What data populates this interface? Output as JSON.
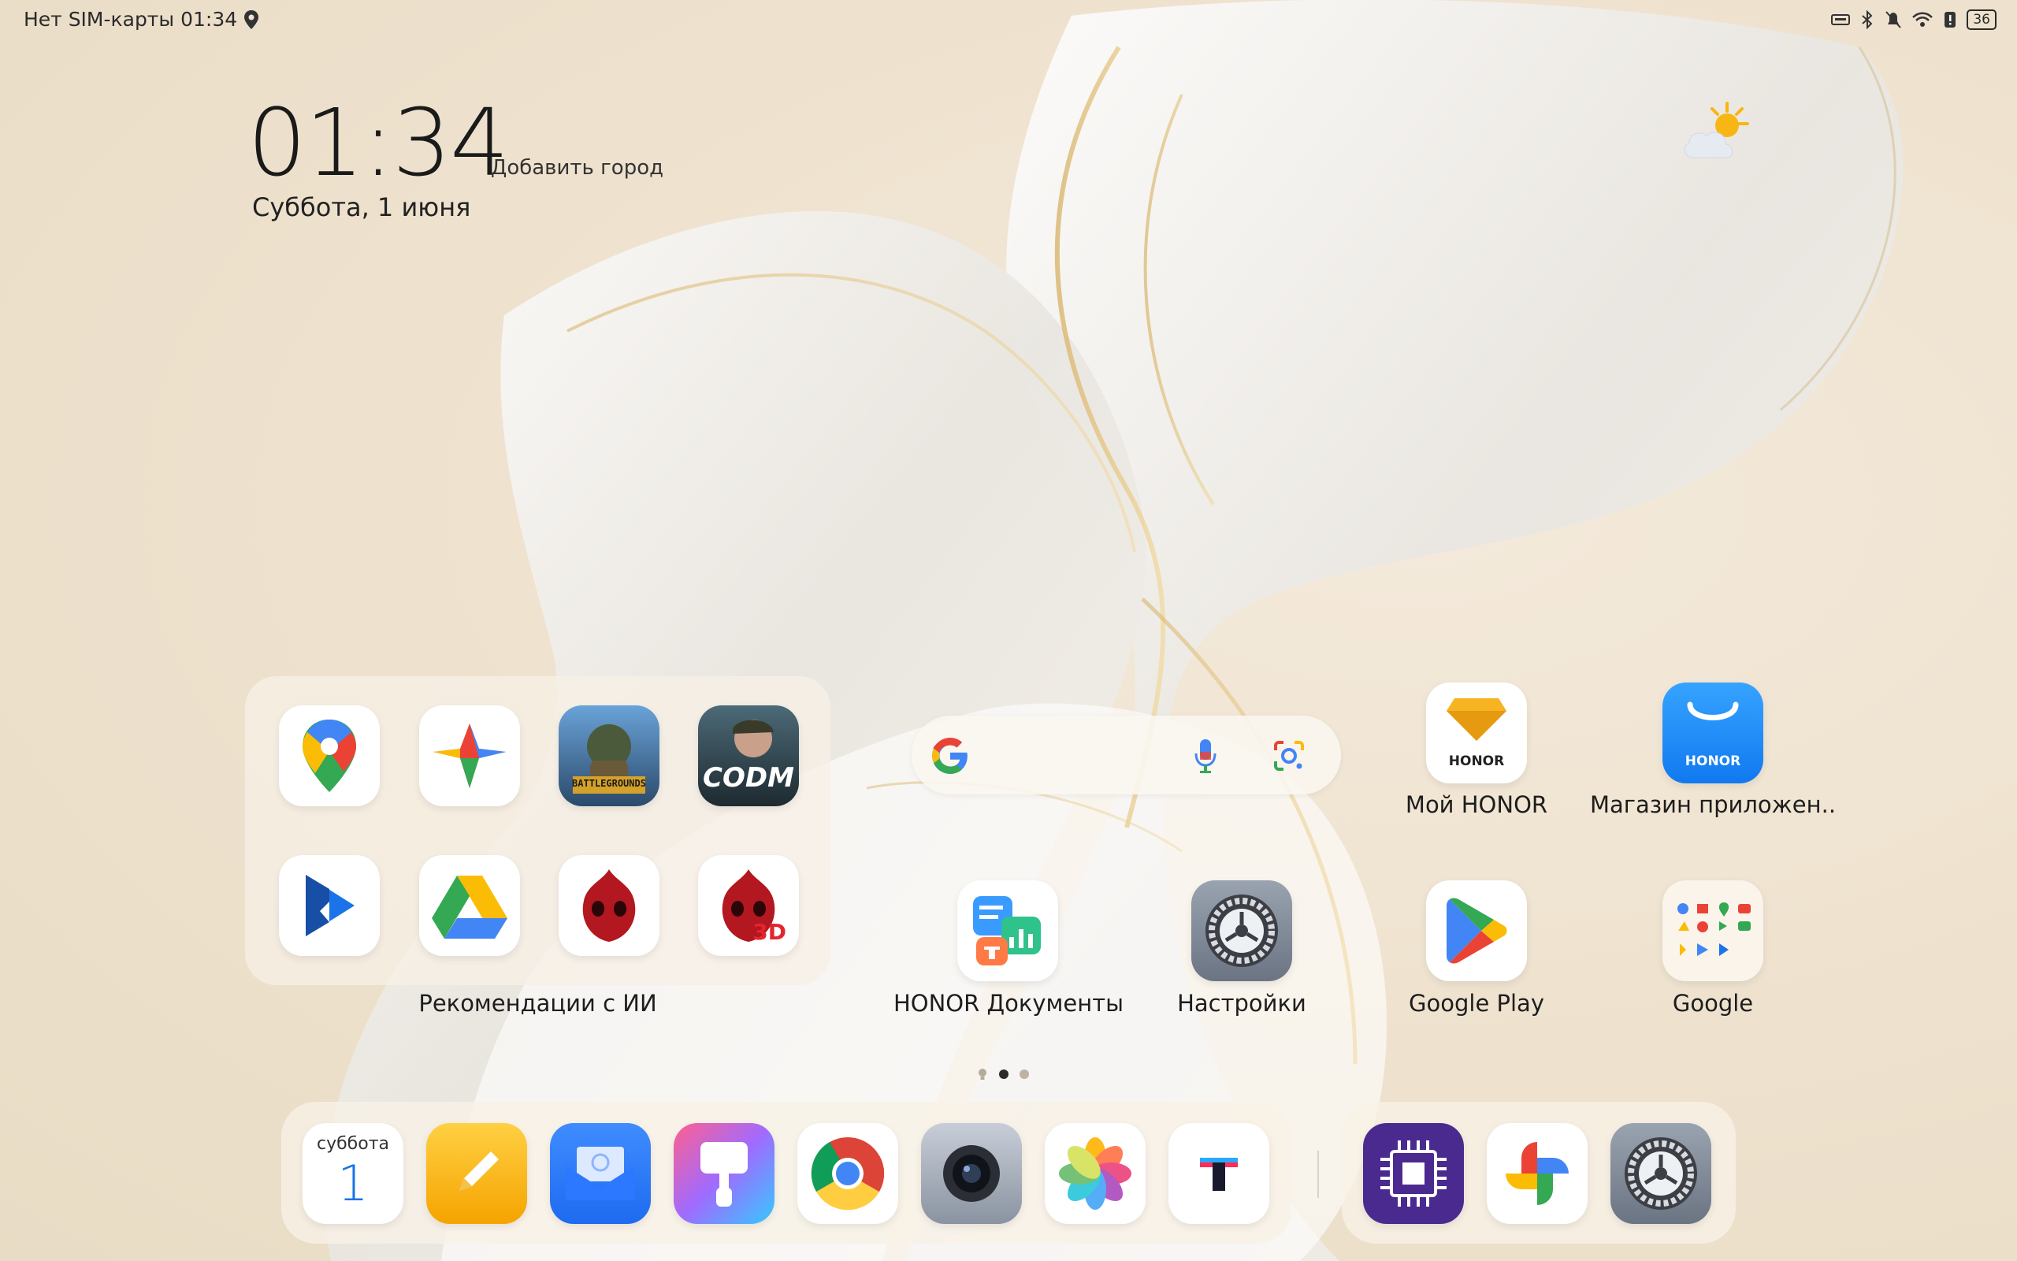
{
  "status": {
    "carrier": "Нет SIM-карты",
    "time": "01:34",
    "battery": "36"
  },
  "clock_widget": {
    "time": "01:34",
    "add_city": "Добавить город",
    "date": "Суббота, 1 июня"
  },
  "folder": {
    "label": "Рекомендации с ИИ",
    "apps": [
      "google-maps-icon",
      "google-one-icon",
      "pubg-icon",
      "codm-icon",
      "google-play-books-icon",
      "google-drive-icon",
      "antutu-icon",
      "antutu-3d-icon"
    ]
  },
  "pubg_text": "BATTLEGROUNDS",
  "codm_text": "CODM",
  "antutu3d_text": "3D",
  "honor_badge": "HONOR",
  "apps": {
    "my_honor": "Мой HONOR",
    "app_store": "Магазин приложен..",
    "honor_docs": "HONOR Документы",
    "settings": "Настройки",
    "google_play": "Google Play",
    "google": "Google"
  },
  "dock": {
    "calendar_day": "суббота",
    "calendar_num": "1"
  },
  "colors": {
    "google_blue": "#4285F4",
    "google_red": "#EA4335",
    "google_yellow": "#FBBC05",
    "google_green": "#34A853",
    "honor_blue": "#1e8bff"
  }
}
